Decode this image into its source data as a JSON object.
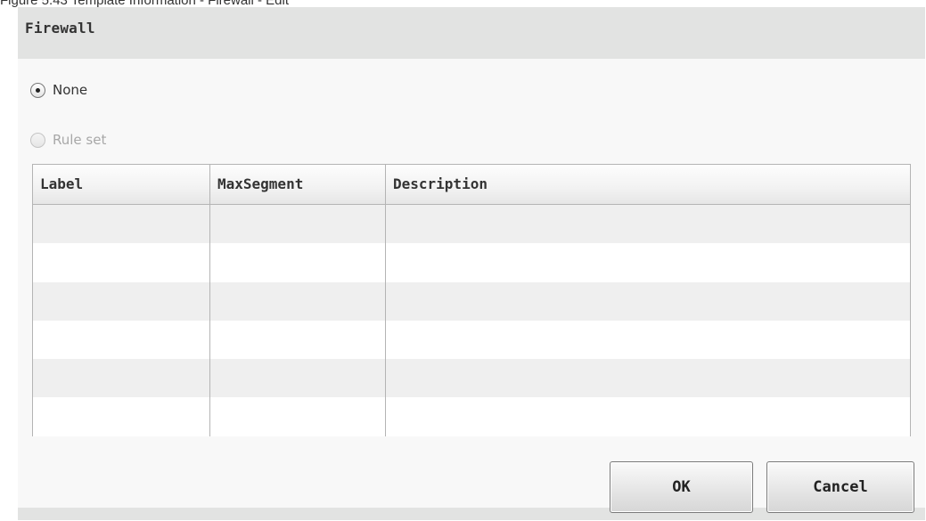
{
  "caption": "Figure 5.43 Template Information - Firewall - Edit",
  "dialog": {
    "title": "Firewall",
    "radios": [
      {
        "label": "None",
        "checked": true,
        "enabled": true
      },
      {
        "label": "Rule set",
        "checked": false,
        "enabled": false
      }
    ],
    "table": {
      "columns": [
        "Label",
        "MaxSegment",
        "Description"
      ],
      "rows": [
        [
          "",
          "",
          ""
        ],
        [
          "",
          "",
          ""
        ],
        [
          "",
          "",
          ""
        ],
        [
          "",
          "",
          ""
        ],
        [
          "",
          "",
          ""
        ],
        [
          "",
          "",
          ""
        ]
      ]
    },
    "buttons": {
      "ok": "OK",
      "cancel": "Cancel"
    }
  }
}
